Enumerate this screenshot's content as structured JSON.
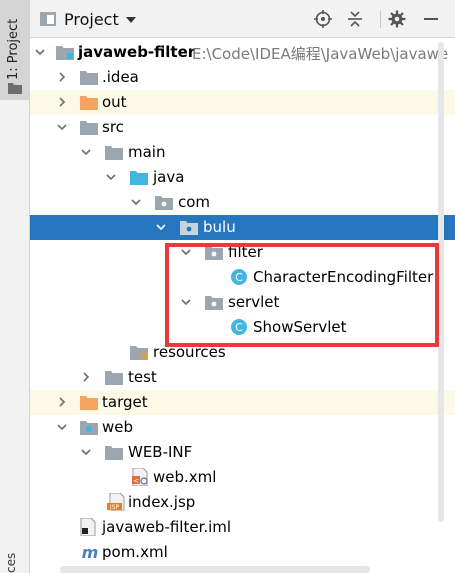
{
  "side_panel": {
    "tab_label": "1: Project",
    "bottom_label": "ces"
  },
  "toolbar": {
    "title": "Project",
    "icons": [
      "locate-icon",
      "collapse-all-icon",
      "settings-icon",
      "hide-icon"
    ]
  },
  "tree": [
    {
      "label": "javaweb-filter",
      "path": "E:\\Code\\IDEA编程\\JavaWeb\\javawe",
      "icon": "module-folder-icon",
      "expanded": true,
      "bold": true
    },
    {
      "label": ".idea",
      "icon": "folder-icon",
      "expanded": false
    },
    {
      "label": "out",
      "icon": "excluded-folder-icon",
      "expanded": false,
      "excluded": true
    },
    {
      "label": "src",
      "icon": "folder-icon",
      "expanded": true
    },
    {
      "label": "main",
      "icon": "folder-icon",
      "expanded": true
    },
    {
      "label": "java",
      "icon": "source-folder-icon",
      "expanded": true
    },
    {
      "label": "com",
      "icon": "package-icon",
      "expanded": true
    },
    {
      "label": "bulu",
      "icon": "package-icon",
      "expanded": true,
      "selected": true
    },
    {
      "label": "filter",
      "icon": "package-icon",
      "expanded": true
    },
    {
      "label": "CharacterEncodingFilter",
      "icon": "class-icon"
    },
    {
      "label": "servlet",
      "icon": "package-icon",
      "expanded": true
    },
    {
      "label": "ShowServlet",
      "icon": "class-icon"
    },
    {
      "label": "resources",
      "icon": "resources-folder-icon"
    },
    {
      "label": "test",
      "icon": "folder-icon",
      "expanded": false
    },
    {
      "label": "target",
      "icon": "excluded-folder-icon",
      "expanded": false,
      "excluded": true
    },
    {
      "label": "web",
      "icon": "web-folder-icon",
      "expanded": true
    },
    {
      "label": "WEB-INF",
      "icon": "folder-icon",
      "expanded": true
    },
    {
      "label": "web.xml",
      "icon": "xml-file-icon"
    },
    {
      "label": "index.jsp",
      "icon": "jsp-file-icon"
    },
    {
      "label": "javaweb-filter.iml",
      "icon": "iml-file-icon"
    },
    {
      "label": "pom.xml",
      "icon": "maven-file-icon"
    }
  ],
  "colors": {
    "selection": "#2675bf",
    "excluded_bg": "#fcf9e6",
    "highlight_box": "#e8393c"
  }
}
